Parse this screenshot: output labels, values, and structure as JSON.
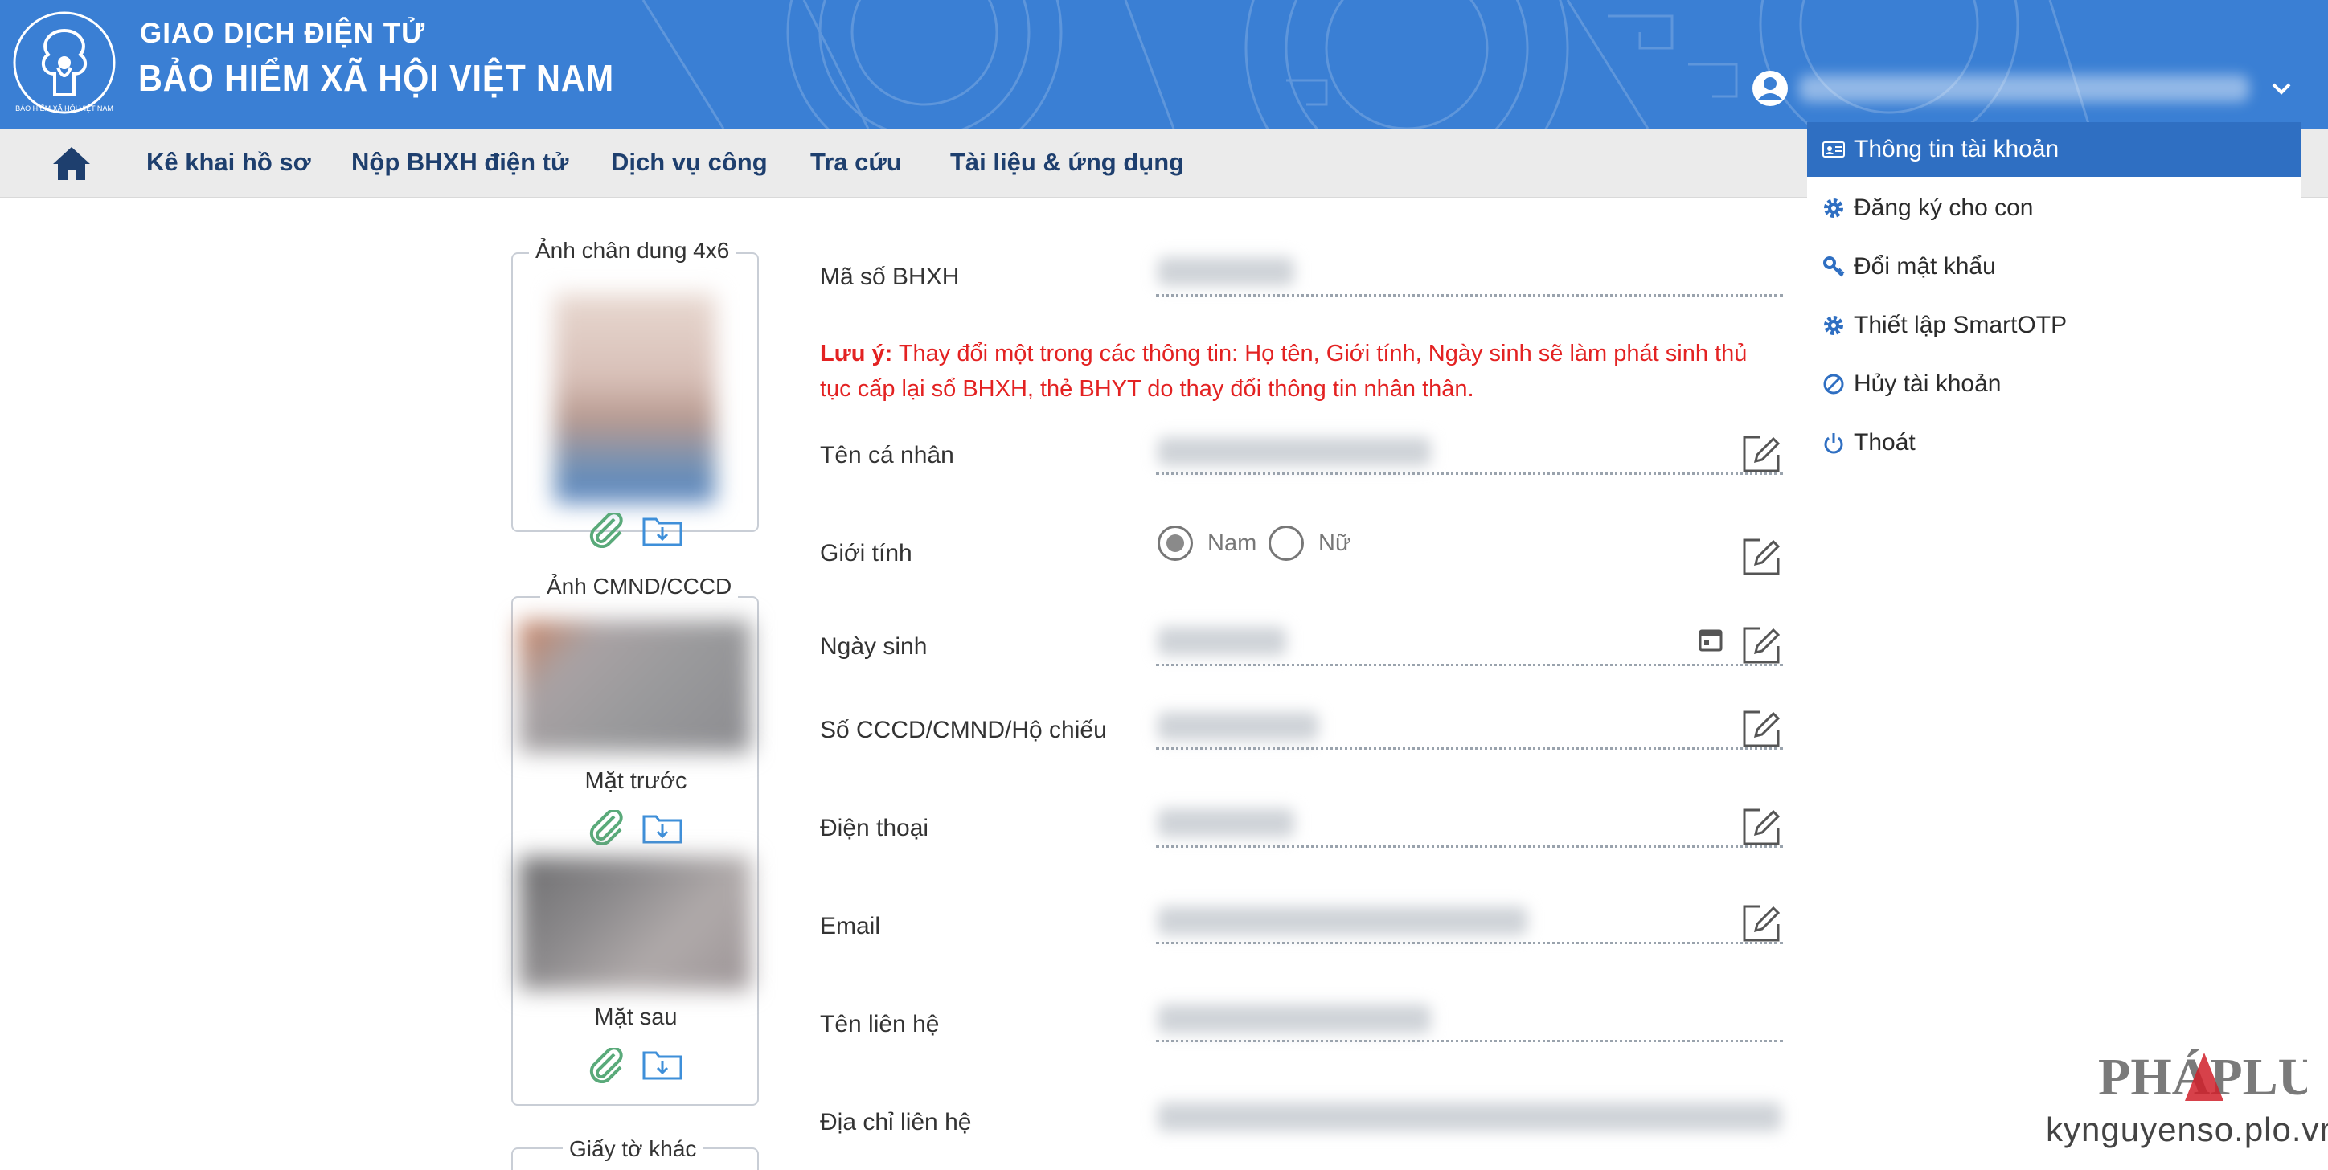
{
  "header": {
    "brand_line1": "GIAO DỊCH ĐIỆN TỬ",
    "brand_line2": "BẢO HIỂM XÃ HỘI VIỆT NAM",
    "logo_text": "BẢO HIỂM XÃ HỘI VIỆT NAM",
    "colors": {
      "primary": "#3a7fd4",
      "nav_text": "#1e3f6e",
      "note": "#e32222",
      "menu_active": "#2f6fc2"
    }
  },
  "nav": {
    "home_icon": "home-icon",
    "items": [
      {
        "label": "Kê khai hồ sơ"
      },
      {
        "label": "Nộp BHXH điện tử"
      },
      {
        "label": "Dịch vụ công"
      },
      {
        "label": "Tra cứu"
      },
      {
        "label": "Tài liệu & ứng dụng"
      }
    ]
  },
  "account_menu": {
    "items": [
      {
        "label": "Thông tin tài khoản",
        "icon": "id-card-icon",
        "active": true
      },
      {
        "label": "Đăng ký cho con",
        "icon": "gear-icon"
      },
      {
        "label": "Đổi mật khẩu",
        "icon": "key-icon"
      },
      {
        "label": "Thiết lập SmartOTP",
        "icon": "gear-icon"
      },
      {
        "label": "Hủy tài khoản",
        "icon": "ban-icon"
      },
      {
        "label": "Thoát",
        "icon": "power-icon"
      }
    ]
  },
  "photos": {
    "portrait_title": "Ảnh chân dung 4x6",
    "id_title": "Ảnh CMND/CCCD",
    "front_label": "Mặt trước",
    "back_label": "Mặt sau",
    "other_title": "Giấy tờ khác"
  },
  "form": {
    "ma_so_label": "Mã số BHXH",
    "note_prefix": "Lưu ý:",
    "note_text": " Thay đổi một trong các thông tin: Họ tên, Giới tính, Ngày sinh sẽ làm phát sinh thủ tục cấp lại sổ BHXH, thẻ BHYT do thay đổi thông tin nhân thân.",
    "ten_label": "Tên cá nhân",
    "gioi_tinh_label": "Giới tính",
    "gender_options": [
      "Nam",
      "Nữ"
    ],
    "gender_selected": "Nam",
    "ngay_sinh_label": "Ngày sinh",
    "so_cccd_label": "Số CCCD/CMND/Hộ chiếu",
    "dien_thoai_label": "Điện thoại",
    "email_label": "Email",
    "ten_lien_he_label": "Tên liên hệ",
    "dia_chi_label": "Địa chỉ liên hệ"
  },
  "watermark": {
    "logo": "PHÁPLUẬT",
    "site": "kynguyenso.plo.vn"
  }
}
